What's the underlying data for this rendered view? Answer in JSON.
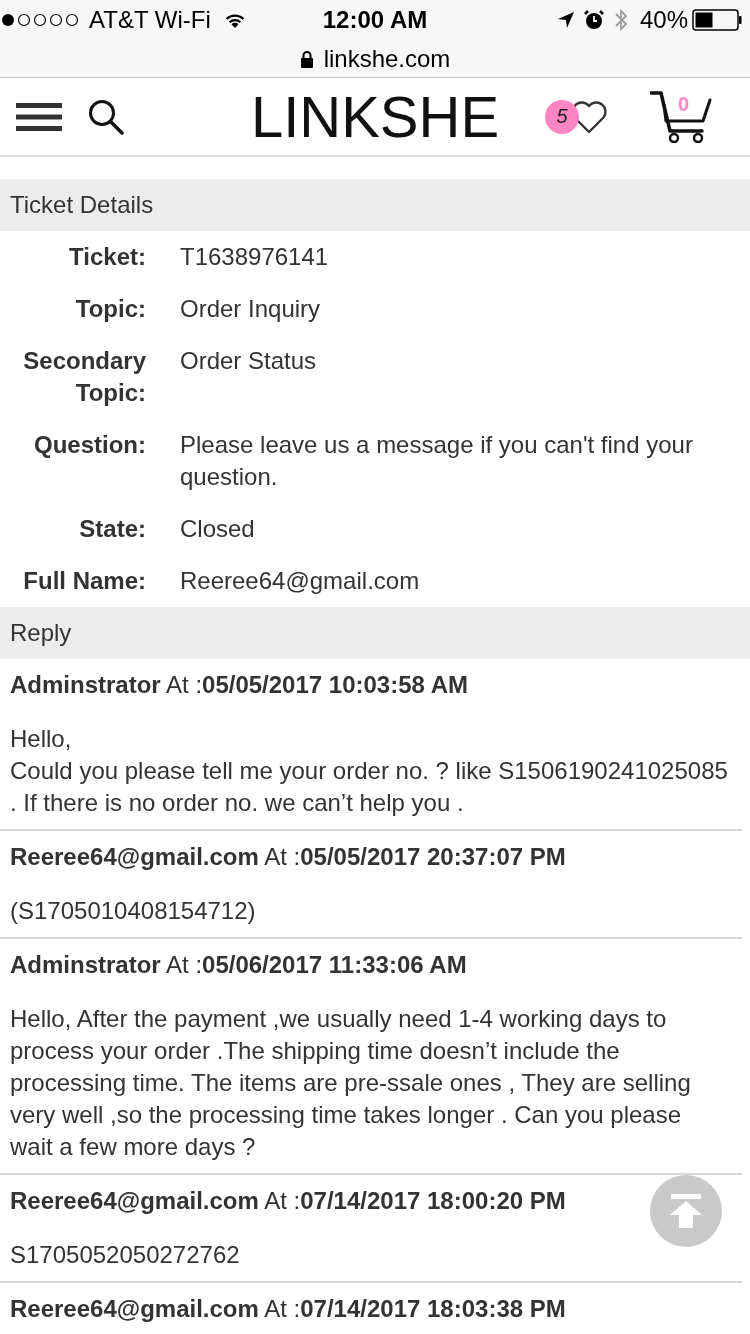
{
  "status_bar": {
    "carrier": "AT&T Wi-Fi",
    "time": "12:00 AM",
    "battery": "40%"
  },
  "address_bar": {
    "url": "linkshe.com"
  },
  "header": {
    "logo": "LINKSHE",
    "wishlist_count": "5",
    "cart_count": "0"
  },
  "ticket_details": {
    "title": "Ticket Details",
    "fields": [
      {
        "label": "Ticket:",
        "value": "T1638976141"
      },
      {
        "label": "Topic:",
        "value": "Order Inquiry"
      },
      {
        "label": "Secondary Topic:",
        "value": "Order Status"
      },
      {
        "label": "Question:",
        "value": "Please leave us a message if you can't find your question."
      },
      {
        "label": "State:",
        "value": "Closed"
      },
      {
        "label": "Full Name:",
        "value": "Reeree64@gmail.com"
      }
    ]
  },
  "replies": {
    "title": "Reply",
    "items": [
      {
        "heading": "**Adminstrator** At :**05/05/2017 10:03:58 AM**",
        "body": [
          "Hello,",
          "Could you please tell me your order no. ? like S1506190241025085 . If there is no order no. we can’t help you ."
        ]
      },
      {
        "heading": "**Reeree64@gmail.com** At :**05/05/2017 20:37:07 PM**",
        "body": [
          "(S1705010408154712)"
        ]
      },
      {
        "heading": "**Adminstrator** At :**05/06/2017 11:33:06 AM**",
        "body": [
          "Hello, After the payment ,we usually need 1-4 working days to process your order .The shipping time doesn’t include the processing time. The items are pre-ssale ones , They are selling very well ,so the processing time takes longer . Can you please wait a few more days ?"
        ]
      },
      {
        "heading": "**Reeree64@gmail.com** At :**07/14/2017 18:00:20 PM**",
        "body": [
          "S1705052050272762"
        ]
      },
      {
        "heading": "**Reeree64@gmail.com** At :**07/14/2017 18:03:38 PM**"
      }
    ]
  }
}
